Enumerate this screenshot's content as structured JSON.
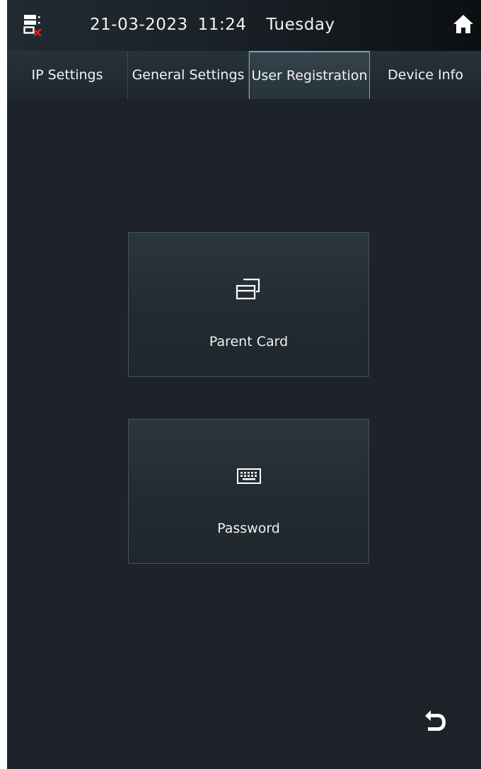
{
  "status_bar": {
    "network_icon": "network-disconnected-icon",
    "date": "21-03-2023",
    "time": "11:24",
    "weekday": "Tuesday",
    "home_icon": "home-icon"
  },
  "tabs": [
    {
      "label": "IP Settings",
      "active": false
    },
    {
      "label": "General Settings",
      "active": false
    },
    {
      "label": "User Registration",
      "active": true
    },
    {
      "label": "Device Info",
      "active": false
    }
  ],
  "tiles": [
    {
      "label": "Parent Card",
      "icon": "card-icon"
    },
    {
      "label": "Password",
      "icon": "keyboard-icon"
    }
  ],
  "back_icon": "back-arrow-icon",
  "colors": {
    "background": "#1d2329",
    "accent": "#5fb3b3",
    "error": "#e0201f"
  }
}
